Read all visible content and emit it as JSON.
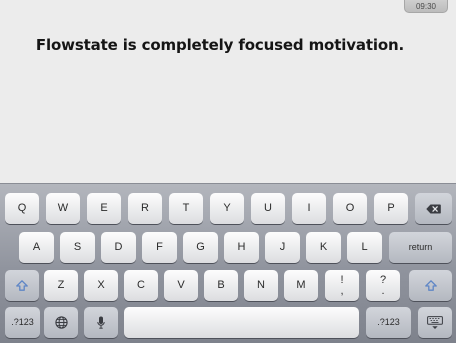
{
  "status": {
    "time": "09:30"
  },
  "editor": {
    "text": "Flowstate is completely focused motivation."
  },
  "keyboard": {
    "row1": [
      "Q",
      "W",
      "E",
      "R",
      "T",
      "Y",
      "U",
      "I",
      "O",
      "P"
    ],
    "row2": [
      "A",
      "S",
      "D",
      "F",
      "G",
      "H",
      "J",
      "K",
      "L"
    ],
    "row3": [
      "Z",
      "X",
      "C",
      "V",
      "B",
      "N",
      "M"
    ],
    "return_label": "return",
    "numbers_label": ".?123",
    "punct1_top": "!",
    "punct1_bottom": ",",
    "punct2_top": "?",
    "punct2_bottom": ".",
    "icons": {
      "backspace": "backspace-icon",
      "shift": "shift-arrow-icon",
      "globe": "globe-icon",
      "mic": "microphone-icon",
      "hide": "keyboard-hide-icon"
    },
    "colors": {
      "shift_arrow": "#5f86c6"
    }
  }
}
